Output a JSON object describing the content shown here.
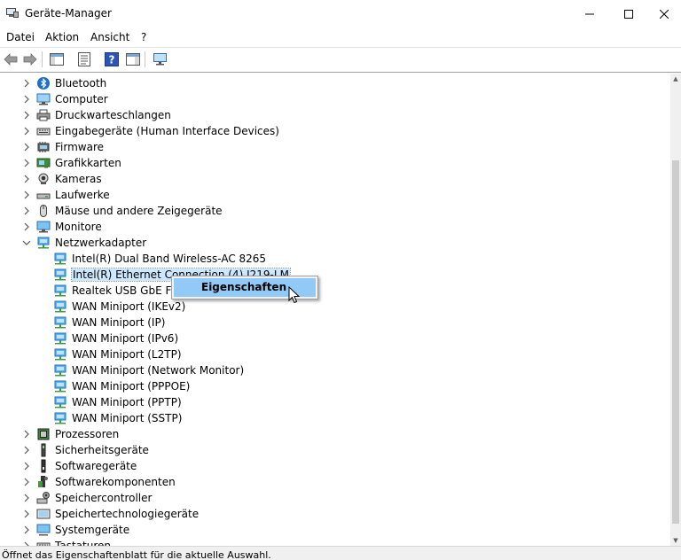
{
  "window": {
    "title": "Geräte-Manager",
    "controls": {
      "minimize": "—",
      "maximize": "☐",
      "close": "✕"
    }
  },
  "menubar": {
    "items": [
      "Datei",
      "Aktion",
      "Ansicht",
      "?"
    ]
  },
  "toolbar": {
    "buttons": [
      "back-arrow-icon",
      "forward-arrow-icon",
      "properties-pane-icon",
      "list-view-icon",
      "help-icon",
      "details-view-icon",
      "monitor-network-icon"
    ]
  },
  "tree": {
    "categories_top": [
      {
        "label": "Bluetooth",
        "icon": "bluetooth-icon"
      },
      {
        "label": "Computer",
        "icon": "computer-icon"
      },
      {
        "label": "Druckwarteschlangen",
        "icon": "printer-icon"
      },
      {
        "label": "Eingabegeräte (Human Interface Devices)",
        "icon": "keyboard-icon"
      },
      {
        "label": "Firmware",
        "icon": "firmware-icon"
      },
      {
        "label": "Grafikkarten",
        "icon": "display-adapter-icon"
      },
      {
        "label": "Kameras",
        "icon": "camera-icon"
      },
      {
        "label": "Laufwerke",
        "icon": "drive-icon"
      },
      {
        "label": "Mäuse und andere Zeigegeräte",
        "icon": "mouse-icon"
      },
      {
        "label": "Monitore",
        "icon": "monitor-icon"
      }
    ],
    "expanded": {
      "label": "Netzwerkadapter",
      "icon": "network-adapter-icon"
    },
    "adapters": [
      "Intel(R) Dual Band Wireless-AC 8265",
      "Intel(R) Ethernet Connection (4) I219-LM",
      "Realtek USB GbE Fam",
      "WAN Miniport (IKEv2)",
      "WAN Miniport (IP)",
      "WAN Miniport (IPv6)",
      "WAN Miniport (L2TP)",
      "WAN Miniport (Network Monitor)",
      "WAN Miniport (PPPOE)",
      "WAN Miniport (PPTP)",
      "WAN Miniport (SSTP)"
    ],
    "selected_adapter_index": 1,
    "categories_bottom": [
      {
        "label": "Prozessoren",
        "icon": "processor-icon"
      },
      {
        "label": "Sicherheitsgeräte",
        "icon": "security-device-icon"
      },
      {
        "label": "Softwaregeräte",
        "icon": "software-device-icon"
      },
      {
        "label": "Softwarekomponenten",
        "icon": "software-component-icon"
      },
      {
        "label": "Speichercontroller",
        "icon": "storage-controller-icon"
      },
      {
        "label": "Speichertechnologiegeräte",
        "icon": "storage-tech-icon"
      },
      {
        "label": "Systemgeräte",
        "icon": "system-device-icon"
      },
      {
        "label": "Tastaturen",
        "icon": "keyboard-icon"
      }
    ]
  },
  "context_menu": {
    "items": [
      "Eigenschaften"
    ]
  },
  "statusbar": {
    "text": "Öffnet das Eigenschaftenblatt für die aktuelle Auswahl."
  },
  "colors": {
    "selection": "#cce8ff",
    "menu_highlight": "#91c9f7",
    "network_icon": "#1e7fd0",
    "network_cable": "#3aa13a"
  }
}
